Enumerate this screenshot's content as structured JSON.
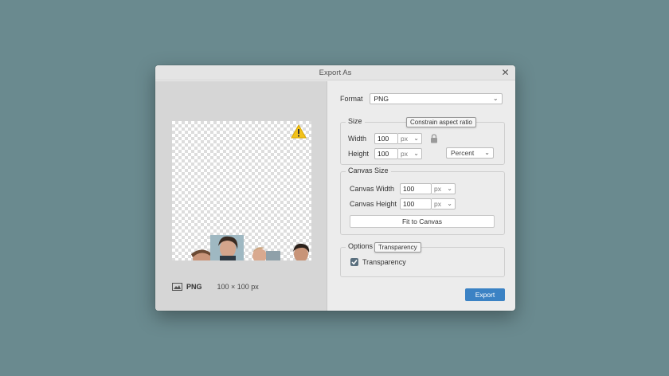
{
  "dialog": {
    "title": "Export As"
  },
  "preview": {
    "format_label": "PNG",
    "dimensions_label": "100 × 100 px"
  },
  "format": {
    "label": "Format",
    "value": "PNG"
  },
  "size": {
    "title": "Size",
    "tooltip": "Constrain aspect ratio",
    "width_label": "Width",
    "width_value": "100",
    "width_unit": "px",
    "height_label": "Height",
    "height_value": "100",
    "height_unit": "px",
    "scale_mode": "Percent"
  },
  "canvas_size": {
    "title": "Canvas Size",
    "width_label": "Canvas Width",
    "width_value": "100",
    "width_unit": "px",
    "height_label": "Canvas Height",
    "height_value": "100",
    "height_unit": "px",
    "fit_button": "Fit to Canvas"
  },
  "options": {
    "title": "Options",
    "tooltip": "Transparency",
    "transparency_label": "Transparency",
    "transparency_checked": true
  },
  "actions": {
    "export_label": "Export"
  },
  "colors": {
    "accent": "#3b82c4",
    "warning": "#f2c21b"
  }
}
